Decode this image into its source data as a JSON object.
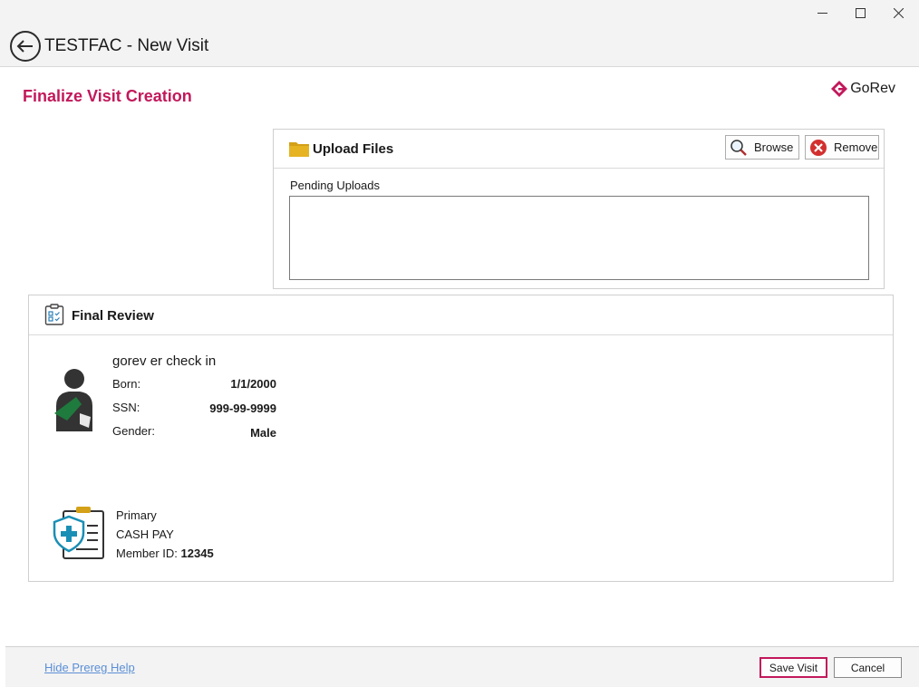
{
  "header": {
    "title": "TESTFAC - New Visit"
  },
  "page": {
    "heading": "Finalize Visit Creation",
    "brand": "GoRev"
  },
  "upload": {
    "title": "Upload Files",
    "browse_label": "Browse",
    "remove_label": "Remove",
    "pending_label": "Pending Uploads"
  },
  "review": {
    "title": "Final Review",
    "patient": {
      "name": "gorev er check in",
      "fields": [
        {
          "label": "Born:",
          "value": "1/1/2000"
        },
        {
          "label": "SSN:",
          "value": "999-99-9999"
        },
        {
          "label": "Gender:",
          "value": "Male"
        }
      ]
    },
    "insurance": {
      "rank": "Primary",
      "payer": "CASH PAY",
      "member_id_label": "Member ID:",
      "member_id": "12345"
    }
  },
  "footer": {
    "help_link": "Hide Prereg Help",
    "save_label": "Save Visit",
    "cancel_label": "Cancel"
  },
  "colors": {
    "accent": "#c2185b",
    "link": "#5b8fd6",
    "folder": "#d4a017",
    "patient_sling": "#1f7a3d",
    "shield": "#1a8fb5"
  }
}
